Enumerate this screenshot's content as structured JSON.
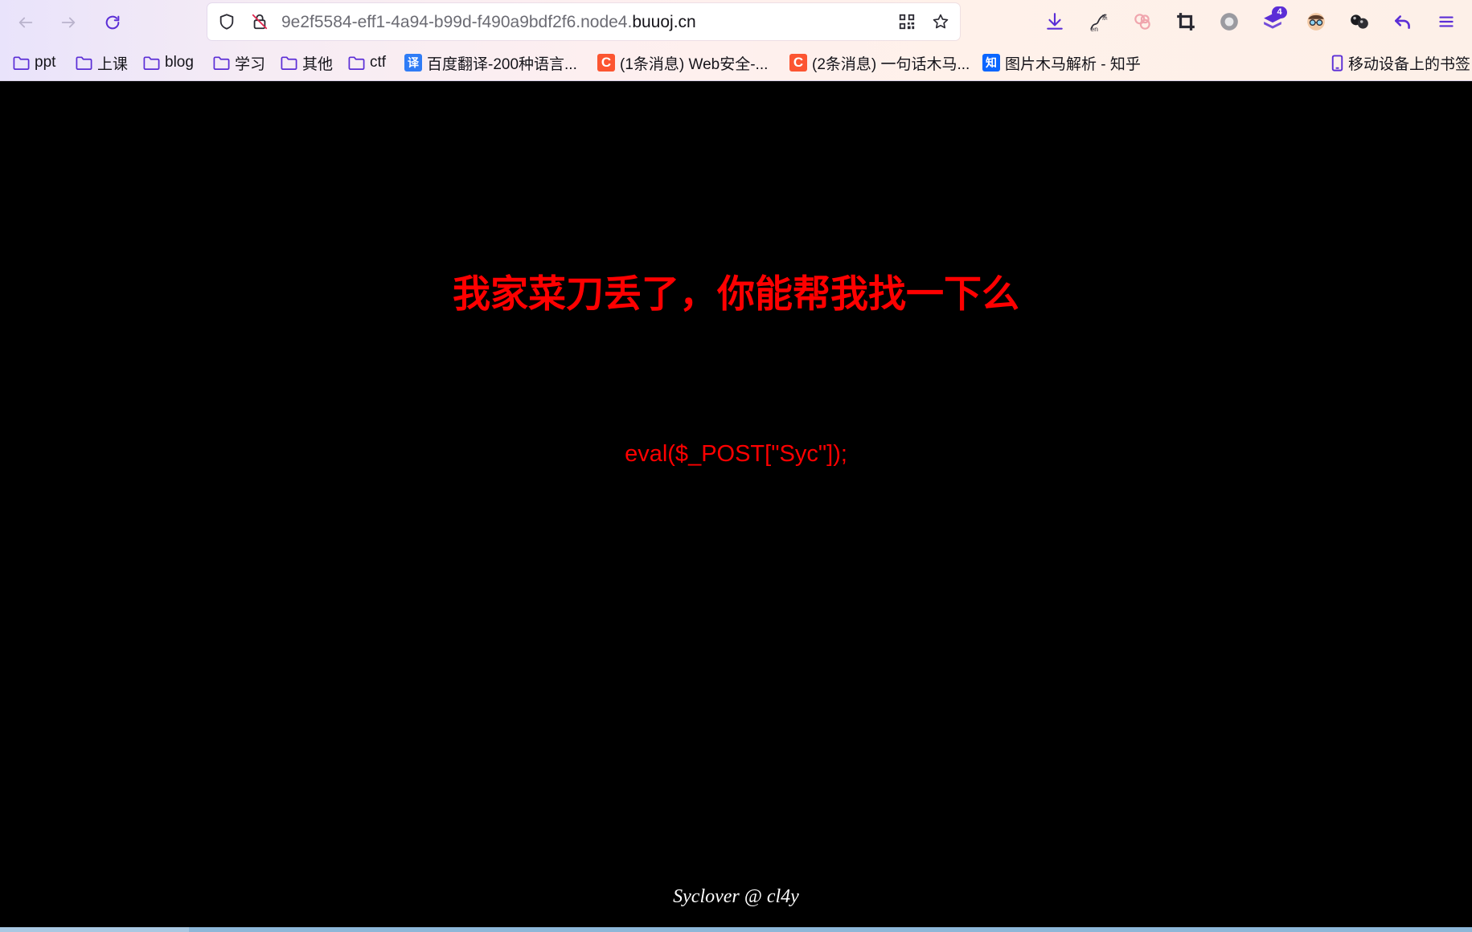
{
  "browser": {
    "url_prefix": "9e2f5584-eff1-4a94-b99d-f490a9bdf2f6.node4.",
    "url_domain": "buuoj.cn",
    "extension_badge": "4",
    "accent_color": "#5b2ed6"
  },
  "bookmarks": [
    {
      "label": "ppt",
      "icon": "folder-icon"
    },
    {
      "label": "上课",
      "icon": "folder-icon"
    },
    {
      "label": "blog",
      "icon": "folder-icon"
    },
    {
      "label": "学习",
      "icon": "folder-icon"
    },
    {
      "label": "其他",
      "icon": "folder-icon"
    },
    {
      "label": "ctf",
      "icon": "folder-icon"
    },
    {
      "label": "百度翻译-200种语言...",
      "icon": "translate-favicon",
      "glyph": "译"
    },
    {
      "label": "(1条消息) Web安全-...",
      "icon": "csdn-favicon",
      "glyph": "C"
    },
    {
      "label": "(2条消息) 一句话木马...",
      "icon": "csdn-favicon",
      "glyph": "C"
    },
    {
      "label": "图片木马解析 - 知乎",
      "icon": "zhihu-favicon",
      "glyph": "知"
    }
  ],
  "mobile_bookmarks": "移动设备上的书签",
  "page": {
    "headline": "我家菜刀丢了，你能帮我找一下么",
    "code": "eval($_POST[\"Syc\"]);",
    "footer": "Syclover @ cl4y",
    "text_color": "#ff0000",
    "background": "#000000"
  }
}
